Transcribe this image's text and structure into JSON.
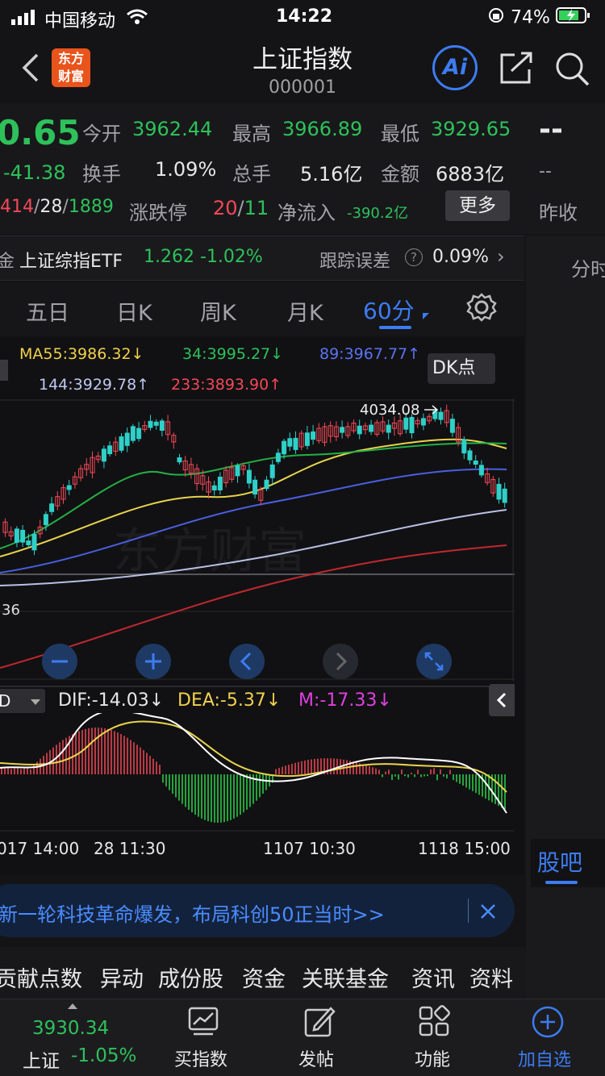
{
  "status_bar": {
    "carrier": "中国移动",
    "time": "14:22",
    "battery": "74%"
  },
  "header": {
    "logo_line1": "东方",
    "logo_line2": "财富",
    "title": "上证指数",
    "code": "000001",
    "ai_label": "Ai"
  },
  "quote": {
    "price": "0.65",
    "change": "-41.38",
    "open_label": "今开",
    "open": "3962.44",
    "high_label": "最高",
    "high": "3966.89",
    "low_label": "最低",
    "low": "3929.65",
    "turnover_label": "换手",
    "turnover": "1.09%",
    "volume_label": "总手",
    "volume": "5.16亿",
    "amount_label": "金额",
    "amount": "6883亿",
    "up_count": "414",
    "flat_count": "28",
    "down_count": "1889",
    "sep": "/",
    "limit_label": "涨跌停",
    "limit_up": "20",
    "limit_down": "11",
    "inflow_label": "净流入",
    "inflow": "-390.2亿",
    "more_label": "更多",
    "prev_close_value": "--",
    "prev_close_value2": "--",
    "prev_close_label": "昨收"
  },
  "etf": {
    "prefix": "金",
    "name": "上证综指ETF",
    "price": "1.262",
    "change": "-1.02%",
    "tracking_label": "跟踪误差",
    "tracking_value": "0.09%"
  },
  "side_tab": "分时",
  "tabs": [
    "五日",
    "日K",
    "周K",
    "月K",
    "60分"
  ],
  "ma": {
    "ma55": "MA55:3986.32",
    "ma34": "34:3995.27",
    "ma89": "89:3967.77",
    "ma144": "144:3929.78",
    "ma233": "233:3893.90",
    "down_arrow": "↓",
    "up_arrow": "↑"
  },
  "dk_label": "DK点",
  "chart_annot": {
    "high_mark": "4034.08",
    "left_price": "36",
    "watermark": "东方财富"
  },
  "macd": {
    "selector": "D",
    "dif": "DIF:-14.03",
    "dea": "DEA:-5.37",
    "m": "M:-17.33",
    "arrow": "↓"
  },
  "x_axis": [
    "017 14:00",
    "28 11:30",
    "1107 10:30",
    "1118 15:00"
  ],
  "guba": "股吧",
  "banner": "新一轮科技革命爆发，布局科创50正当时>>",
  "bottom_tabs": [
    "贡献点数",
    "异动",
    "成份股",
    "资金",
    "关联基金",
    "资讯",
    "资料"
  ],
  "bottom_bar": {
    "index_value": "3930.34",
    "index_name": "上证",
    "index_change": "-1.05%",
    "items": [
      "买指数",
      "发帖",
      "功能",
      "加自选"
    ]
  },
  "colors": {
    "up": "#f24957",
    "down": "#2ec15a",
    "accent": "#3d7cf2",
    "bg": "#141416"
  }
}
